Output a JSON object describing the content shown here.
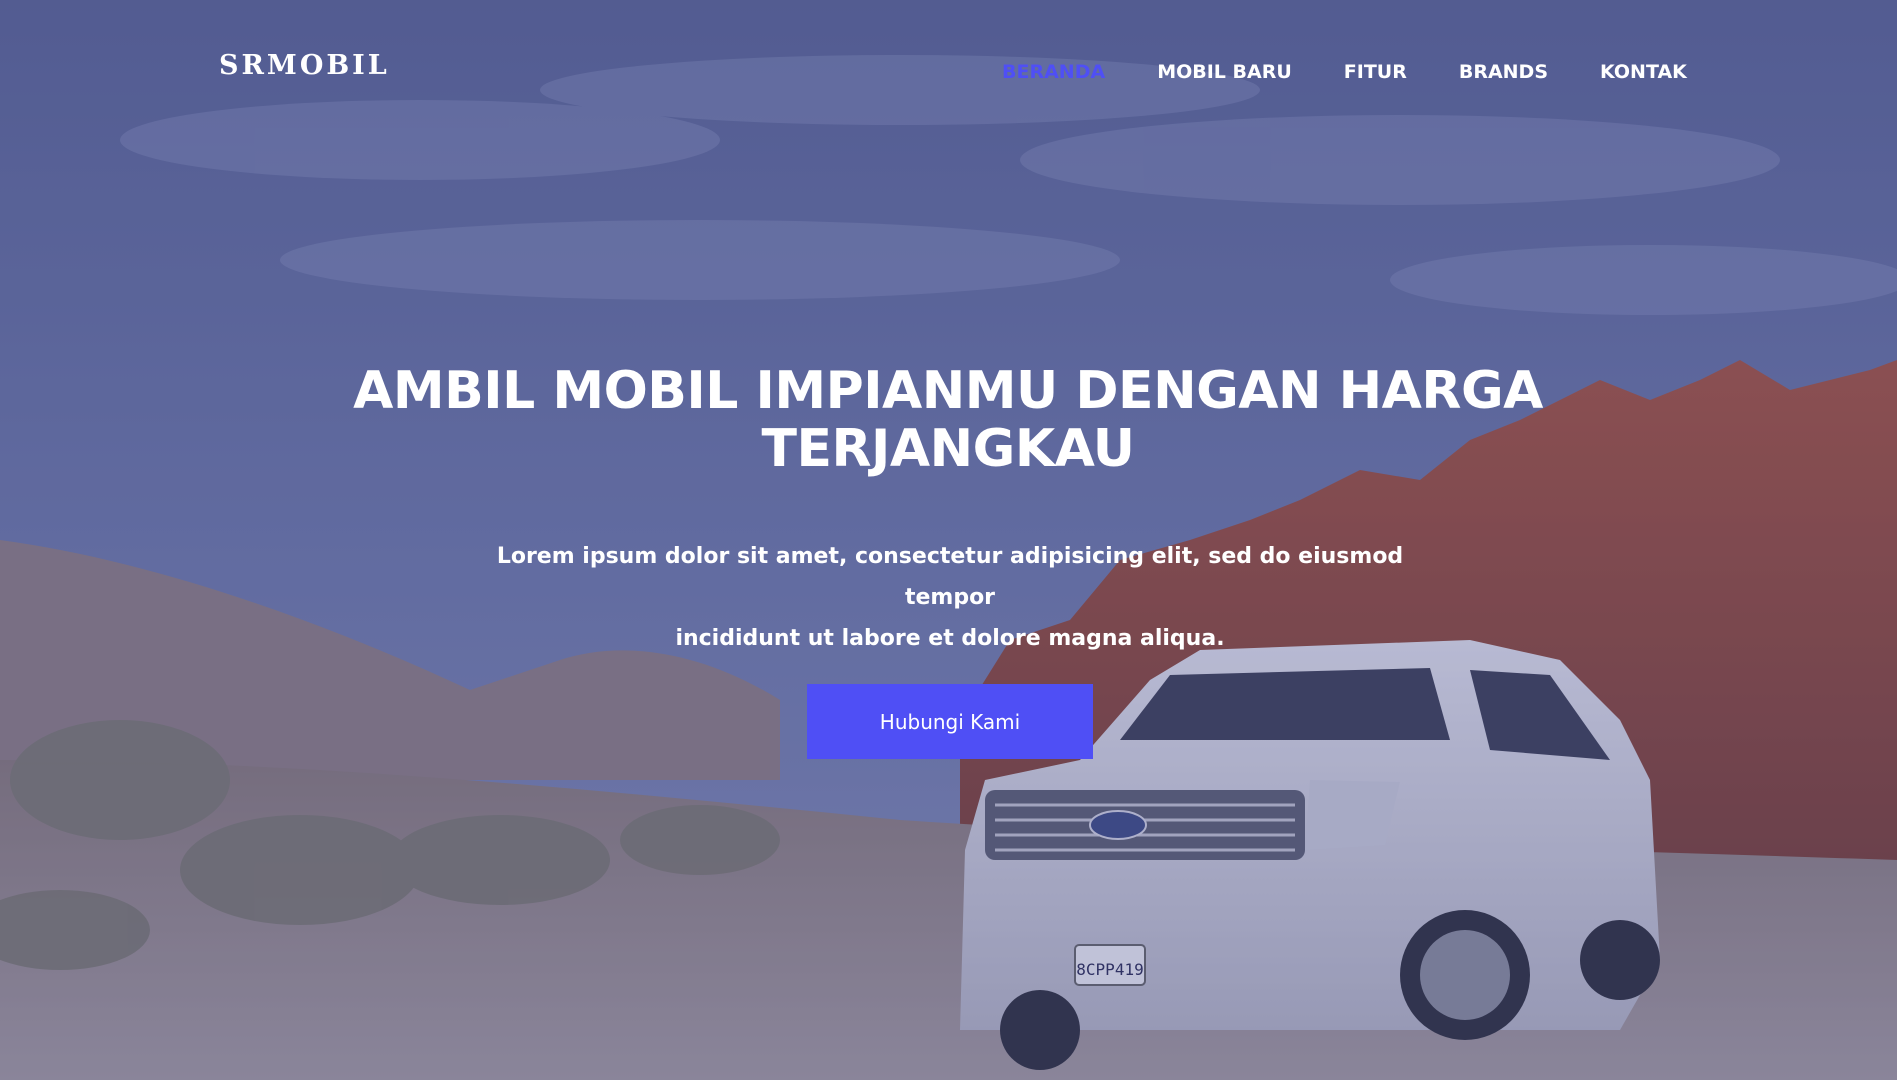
{
  "header": {
    "logo": "SRMOBIL",
    "nav": [
      {
        "label": "BERANDA",
        "active": true
      },
      {
        "label": "MOBIL BARU",
        "active": false
      },
      {
        "label": "FITUR",
        "active": false
      },
      {
        "label": "BRANDS",
        "active": false
      },
      {
        "label": "KONTAK",
        "active": false
      }
    ]
  },
  "hero": {
    "title_line1": "AMBIL MOBIL IMPIANMU DENGAN HARGA",
    "title_line2": "TERJANGKAU",
    "subtitle_line1": "Lorem ipsum dolor sit amet, consectetur adipisicing elit, sed do eiusmod tempor",
    "subtitle_line2": "incididunt ut labore et dolore magna aliqua.",
    "cta_label": "Hubungi Kami",
    "plate_text": "8CPP419"
  },
  "colors": {
    "accent": "#4f4ff5",
    "text": "#ffffff",
    "overlay": "#40488c"
  },
  "background_image": "hero-desert-suv-photo"
}
